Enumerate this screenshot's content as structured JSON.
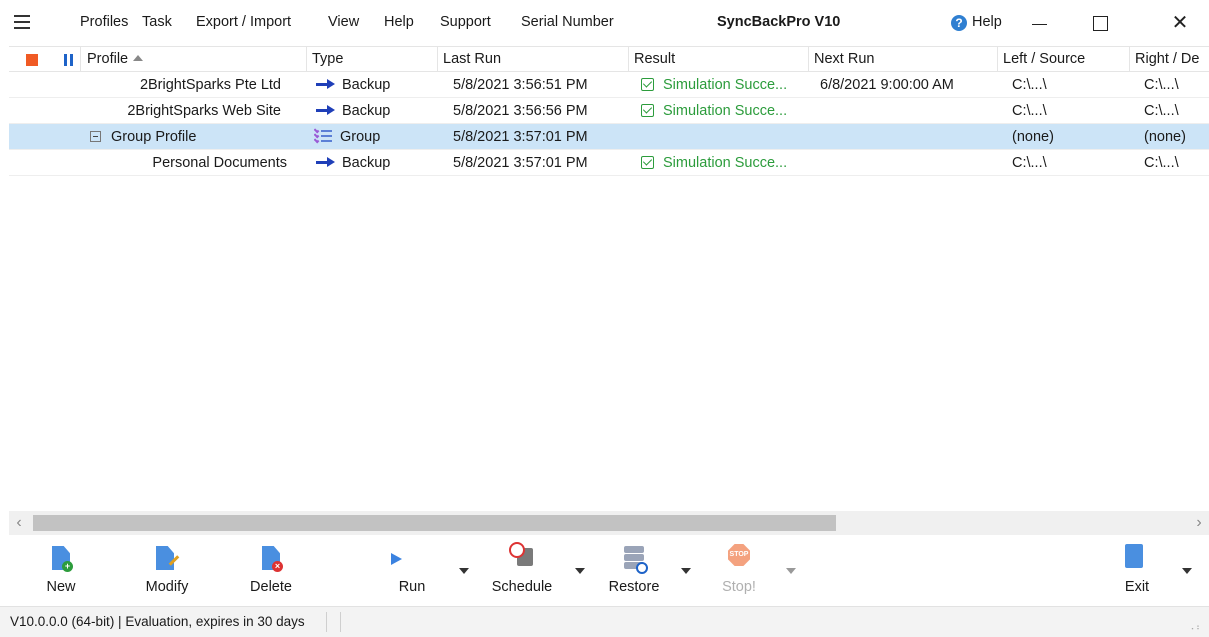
{
  "menu": {
    "items": [
      "Profiles",
      "Task",
      "Export / Import",
      "View",
      "Help",
      "Support",
      "Serial Number"
    ],
    "app_title": "SyncBackPro V10",
    "help_link": "Help",
    "help_icon_glyph": "?",
    "close_glyph": "✕"
  },
  "columns": {
    "profile": "Profile",
    "type": "Type",
    "last_run": "Last Run",
    "result": "Result",
    "next_run": "Next Run",
    "left": "Left / Source",
    "right": "Right / De"
  },
  "rows": [
    {
      "profile": "2BrightSparks Pte Ltd",
      "type": "Backup",
      "type_icon": "arrow-right-icon",
      "last_run": "5/8/2021 3:56:51 PM",
      "result": "Simulation Succe...",
      "next_run": "6/8/2021 9:00:00 AM",
      "left": "C:\\...\\",
      "right": "C:\\...\\",
      "selected": false
    },
    {
      "profile": "2BrightSparks Web Site",
      "type": "Backup",
      "type_icon": "arrow-right-icon",
      "last_run": "5/8/2021 3:56:56 PM",
      "result": "Simulation Succe...",
      "next_run": "",
      "left": "C:\\...\\",
      "right": "C:\\...\\",
      "selected": false
    },
    {
      "profile": "Group Profile",
      "type": "Group",
      "type_icon": "group-icon",
      "last_run": "5/8/2021 3:57:01 PM",
      "result": "",
      "next_run": "",
      "left": "(none)",
      "right": "(none)",
      "selected": true
    },
    {
      "profile": "Personal Documents",
      "type": "Backup",
      "type_icon": "arrow-right-icon",
      "last_run": "5/8/2021 3:57:01 PM",
      "result": "Simulation Succe...",
      "next_run": "",
      "left": "C:\\...\\",
      "right": "C:\\...\\",
      "selected": false
    }
  ],
  "scrollbar": {
    "left_glyph": "‹",
    "right_glyph": "›"
  },
  "toolbar": {
    "new": "New",
    "modify": "Modify",
    "delete": "Delete",
    "run": "Run",
    "schedule": "Schedule",
    "restore": "Restore",
    "stop": "Stop!",
    "stop_icon_text": "STOP",
    "exit": "Exit",
    "badge_add": "+",
    "badge_delete": "×"
  },
  "status": {
    "text": "V10.0.0.0 (64-bit) | Evaluation, expires in 30 days",
    "grip": "⠠⠰"
  },
  "colors": {
    "accent": "#1e63c8",
    "stop_red": "#f05a24",
    "success_green": "#2c9c3c",
    "selection": "#cce4f7"
  }
}
